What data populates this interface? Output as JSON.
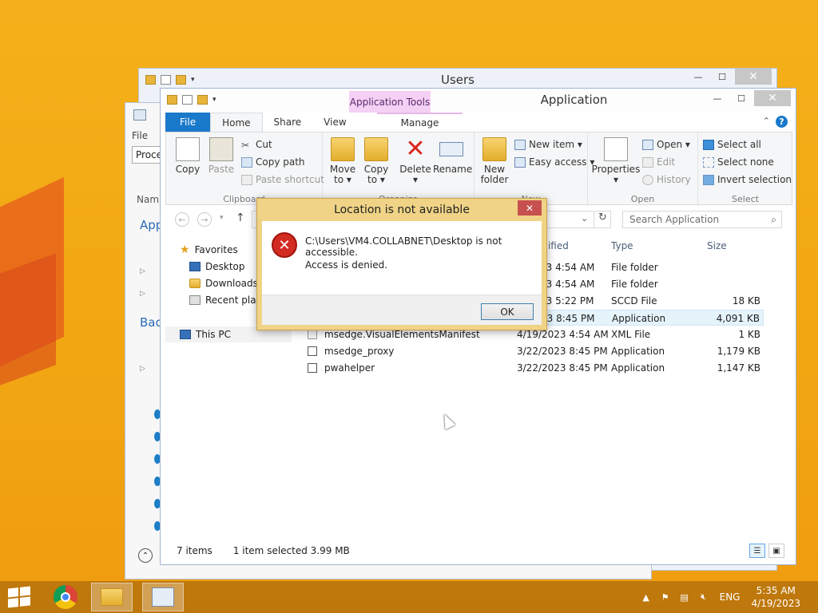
{
  "users_window": {
    "title": "Users"
  },
  "proc_window": {
    "menu_file": "File",
    "tab_label": "Proce",
    "col_name": "Nam",
    "section_apps": "App",
    "section_background": "Bac"
  },
  "main_window": {
    "title": "Application",
    "context_tab": "Application Tools",
    "tabs": {
      "file": "File",
      "home": "Home",
      "share": "Share",
      "view": "View",
      "manage": "Manage"
    },
    "help_icon": "?"
  },
  "ribbon": {
    "clipboard": {
      "label": "Clipboard",
      "copy": "Copy",
      "paste": "Paste",
      "cut": "Cut",
      "copy_path": "Copy path",
      "paste_shortcut": "Paste shortcut"
    },
    "organize": {
      "label": "Organize",
      "move_to": "Move",
      "move_to2": "to ▾",
      "copy_to": "Copy",
      "copy_to2": "to ▾",
      "delete": "Delete",
      "delete2": "▾",
      "rename": "Rename"
    },
    "new": {
      "label": "New",
      "new_folder": "New",
      "new_folder2": "folder",
      "new_item": "New item ▾",
      "easy_access": "Easy access ▾"
    },
    "open": {
      "label": "Open",
      "properties": "Properties",
      "properties2": "▾",
      "open": "Open ▾",
      "edit": "Edit",
      "history": "History"
    },
    "select": {
      "label": "Select",
      "select_all": "Select all",
      "select_none": "Select none",
      "invert": "Invert selection"
    }
  },
  "search": {
    "placeholder": "Search Application"
  },
  "navpane": {
    "favorites": "Favorites",
    "desktop": "Desktop",
    "downloads": "Downloads",
    "recent": "Recent plac",
    "this_pc": "This PC"
  },
  "columns": {
    "modified": "odified",
    "type": "Type",
    "size": "Size"
  },
  "files": [
    {
      "name": "",
      "date": "23 4:54 AM",
      "type": "File folder",
      "size": ""
    },
    {
      "name": "",
      "date": "23 4:54 AM",
      "type": "File folder",
      "size": ""
    },
    {
      "name": "",
      "date": "23 5:22 PM",
      "type": "SCCD File",
      "size": "18 KB"
    },
    {
      "name": "",
      "date": "23 8:45 PM",
      "type": "Application",
      "size": "4,091 KB"
    },
    {
      "name": "msedge.VisualElementsManifest",
      "date": "4/19/2023 4:54 AM",
      "type": "XML File",
      "size": "1 KB"
    },
    {
      "name": "msedge_proxy",
      "date": "3/22/2023 8:45 PM",
      "type": "Application",
      "size": "1,179 KB"
    },
    {
      "name": "pwahelper",
      "date": "3/22/2023 8:45 PM",
      "type": "Application",
      "size": "1,147 KB"
    }
  ],
  "status": {
    "items": "7 items",
    "selected": "1 item selected  3.99 MB"
  },
  "dialog": {
    "title": "Location is not available",
    "message": "C:\\Users\\VM4.COLLABNET\\Desktop is not accessible.",
    "detail": "Access is denied.",
    "ok": "OK"
  },
  "taskbar": {
    "lang": "ENG",
    "time": "5:35 AM",
    "date": "4/19/2023"
  },
  "colors": {
    "accent": "#1979ca",
    "dialog_frame": "#f0d386",
    "close_red": "#c75050",
    "desktop": "#f2a712"
  }
}
